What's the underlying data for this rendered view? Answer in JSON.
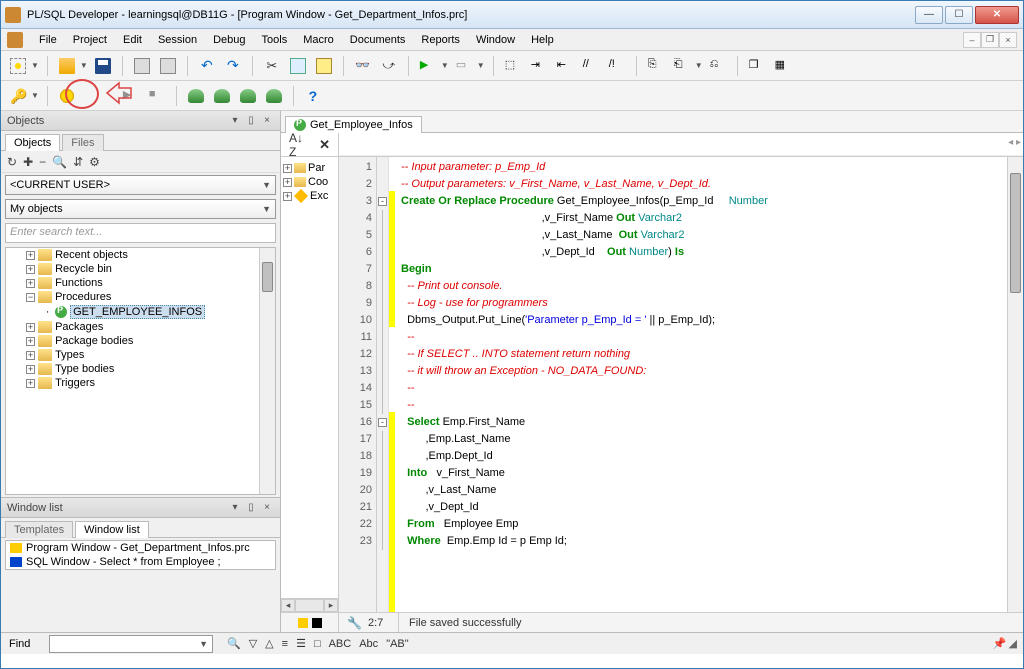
{
  "title": "PL/SQL Developer - learningsql@DB11G - [Program Window - Get_Department_Infos.prc]",
  "menu": {
    "items": [
      "File",
      "Project",
      "Edit",
      "Session",
      "Debug",
      "Tools",
      "Macro",
      "Documents",
      "Reports",
      "Window",
      "Help"
    ]
  },
  "objects_panel": {
    "title": "Objects",
    "tabs": [
      "Objects",
      "Files"
    ],
    "toolbar_icons": [
      "↻",
      "✚",
      "−",
      "🔍",
      "⇵",
      "⚙"
    ],
    "user_dd": "<CURRENT USER>",
    "filter_dd": "My objects",
    "search_placeholder": "Enter search text...",
    "tree": [
      {
        "label": "Recent objects",
        "exp": false
      },
      {
        "label": "Recycle bin",
        "exp": false
      },
      {
        "label": "Functions",
        "exp": false
      },
      {
        "label": "Procedures",
        "exp": true,
        "children": [
          {
            "label": "GET_EMPLOYEE_INFOS",
            "type": "proc",
            "selected": true
          }
        ]
      },
      {
        "label": "Packages",
        "exp": false
      },
      {
        "label": "Package bodies",
        "exp": false
      },
      {
        "label": "Types",
        "exp": false
      },
      {
        "label": "Type bodies",
        "exp": false
      },
      {
        "label": "Triggers",
        "exp": false
      }
    ]
  },
  "window_list": {
    "title": "Window list",
    "tabs": [
      "Templates",
      "Window list"
    ],
    "items": [
      {
        "color": "y",
        "label": "Program Window - Get_Department_Infos.prc"
      },
      {
        "color": "b",
        "label": "SQL Window - Select * from Employee ;"
      }
    ]
  },
  "editor": {
    "tab_label": "Get_Employee_Infos",
    "mini_tree": [
      "Par",
      "Coo",
      "Exc"
    ],
    "cursor": "2:7",
    "status_msg": "File saved successfully",
    "lines": [
      [
        {
          "c": "cm",
          "t": "-- Input parameter: p_Emp_Id"
        }
      ],
      [
        {
          "c": "cm",
          "t": "-- Output parameters: v_First_Name, v_Last_Name, v_Dept_Id."
        }
      ],
      [
        {
          "c": "kw",
          "t": "Create Or Replace Procedure"
        },
        {
          "c": "id",
          "t": " Get_Employee_Infos(p_Emp_Id     "
        },
        {
          "c": "ty",
          "t": "Number"
        }
      ],
      [
        {
          "c": "id",
          "t": "                                              ,v_First_Name "
        },
        {
          "c": "kw",
          "t": "Out"
        },
        {
          "c": "id",
          "t": " "
        },
        {
          "c": "ty",
          "t": "Varchar2"
        }
      ],
      [
        {
          "c": "id",
          "t": "                                              ,v_Last_Name  "
        },
        {
          "c": "kw",
          "t": "Out"
        },
        {
          "c": "id",
          "t": " "
        },
        {
          "c": "ty",
          "t": "Varchar2"
        }
      ],
      [
        {
          "c": "id",
          "t": "                                              ,v_Dept_Id    "
        },
        {
          "c": "kw",
          "t": "Out"
        },
        {
          "c": "id",
          "t": " "
        },
        {
          "c": "ty",
          "t": "Number"
        },
        {
          "c": "id",
          "t": ") "
        },
        {
          "c": "kw",
          "t": "Is"
        }
      ],
      [
        {
          "c": "kw",
          "t": "Begin"
        }
      ],
      [
        {
          "c": "cm",
          "t": "  -- Print out console."
        }
      ],
      [
        {
          "c": "cm",
          "t": "  -- Log - use for programmers"
        }
      ],
      [
        {
          "c": "id",
          "t": "  Dbms_Output.Put_Line("
        },
        {
          "c": "str",
          "t": "'Parameter p_Emp_Id = '"
        },
        {
          "c": "id",
          "t": " || p_Emp_Id);"
        }
      ],
      [
        {
          "c": "cm",
          "t": "  --"
        }
      ],
      [
        {
          "c": "cm",
          "t": "  -- If SELECT .. INTO statement return nothing"
        }
      ],
      [
        {
          "c": "cm",
          "t": "  -- it will throw an Exception - NO_DATA_FOUND:"
        }
      ],
      [
        {
          "c": "cm",
          "t": "  --"
        }
      ],
      [
        {
          "c": "cm",
          "t": "  --"
        }
      ],
      [
        {
          "c": "kw",
          "t": "  Select"
        },
        {
          "c": "id",
          "t": " Emp.First_Name"
        }
      ],
      [
        {
          "c": "id",
          "t": "        ,Emp.Last_Name"
        }
      ],
      [
        {
          "c": "id",
          "t": "        ,Emp.Dept_Id"
        }
      ],
      [
        {
          "c": "kw",
          "t": "  Into"
        },
        {
          "c": "id",
          "t": "   v_First_Name"
        }
      ],
      [
        {
          "c": "id",
          "t": "        ,v_Last_Name"
        }
      ],
      [
        {
          "c": "id",
          "t": "        ,v_Dept_Id"
        }
      ],
      [
        {
          "c": "kw",
          "t": "  From"
        },
        {
          "c": "id",
          "t": "   Employee Emp"
        }
      ],
      [
        {
          "c": "kw",
          "t": "  Where"
        },
        {
          "c": "id",
          "t": "  Emp.Emp Id = p Emp Id;"
        }
      ]
    ],
    "fold": {
      "3": "-",
      "16": "-"
    },
    "highlight_off": [
      1,
      2,
      11,
      12,
      13,
      14,
      15
    ]
  },
  "find": {
    "label": "Find",
    "placeholder": "",
    "tools": [
      "🔍",
      "▽",
      "△",
      "≡",
      "☰",
      "□",
      "ABC",
      "Abc",
      "\"AB\""
    ]
  }
}
